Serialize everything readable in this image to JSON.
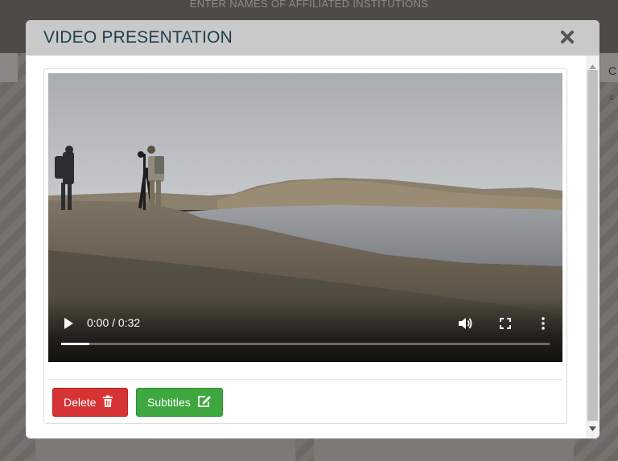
{
  "background": {
    "header_text": "ENTER NAMES OF AFFILIATED INSTITUTIONS",
    "right_label": "C",
    "right_sub": "c"
  },
  "modal": {
    "title": "VIDEO PRESENTATION",
    "close_icon": "close-x-icon",
    "video": {
      "time": "0:00 / 0:32",
      "progress_fraction": 0.058,
      "icons": [
        "play-icon",
        "volume-icon",
        "fullscreen-icon",
        "more-options-icon"
      ]
    },
    "buttons": {
      "delete_label": "Delete",
      "delete_icon": "trash-icon",
      "subtitles_label": "Subtitles",
      "subtitles_icon": "edit-icon"
    }
  },
  "colors": {
    "header_bg": "#c9c9c9",
    "title": "#1e3f4e",
    "delete": "#d63434",
    "subtitles": "#3fa73f"
  }
}
